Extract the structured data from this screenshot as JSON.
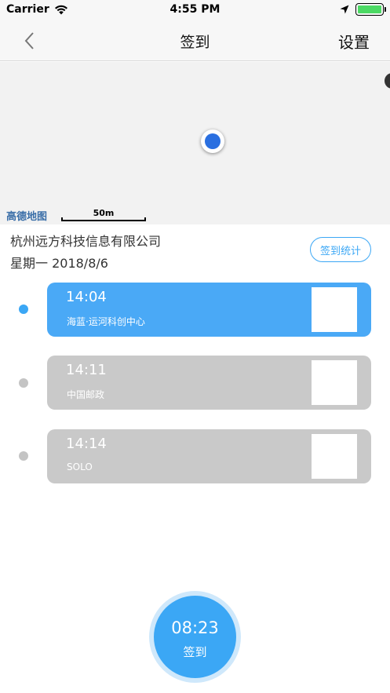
{
  "status_bar": {
    "carrier": "Carrier",
    "time": "4:55 PM"
  },
  "nav": {
    "title": "签到",
    "settings_label": "设置"
  },
  "map": {
    "provider_logo": "高德地图",
    "scale_label": "50m"
  },
  "company": "杭州远方科技信息有限公司",
  "date": "星期一  2018/8/6",
  "stats_button": "签到统计",
  "records": [
    {
      "time": "14:04",
      "place": "海蓝·运河科创中心",
      "active": true
    },
    {
      "time": "14:11",
      "place": "中国邮政",
      "active": false
    },
    {
      "time": "14:14",
      "place": "SOLO",
      "active": false
    }
  ],
  "signin": {
    "time": "08:23",
    "label": "签到"
  },
  "colors": {
    "accent": "#3ba7f5",
    "inactive": "#c9c9c9",
    "location_dot": "#2a6fe0"
  }
}
